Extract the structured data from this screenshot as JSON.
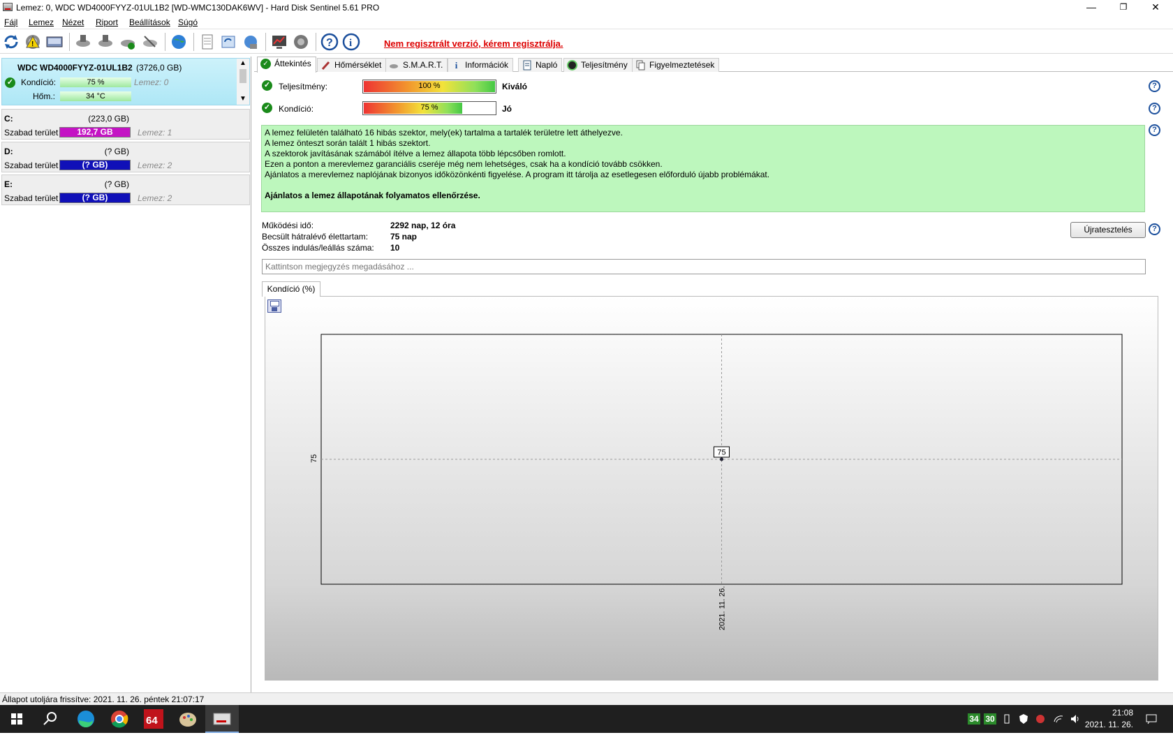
{
  "window": {
    "title": "Lemez: 0, WDC WD4000FYYZ-01UL1B2 [WD-WMC130DAK6WV]  -  Hard Disk Sentinel 5.61 PRO",
    "minimize": "—",
    "restore": "❐",
    "close": "✕"
  },
  "menu": {
    "items": [
      "Fájl",
      "Lemez",
      "Nézet",
      "Riport",
      "Beállítások",
      "Súgó"
    ]
  },
  "toolbar": {
    "register_text": "Nem regisztrált verzió, kérem regisztrálja."
  },
  "disk": {
    "name": "WDC WD4000FYYZ-01UL1B2",
    "size": "(3726,0 GB)",
    "condition_label": "Kondíció:",
    "condition_value": "75 %",
    "condition_fraction": 0.75,
    "disk_index": "Lemez: 0",
    "temp_label": "Hőm.:",
    "temp_value": "34 °C"
  },
  "volumes": [
    {
      "name": "C:",
      "size": "(223,0 GB)",
      "free_label": "Szabad terület",
      "free_value": "192,7 GB",
      "disk": "Lemez: 1",
      "bar_color": "#c413c4"
    },
    {
      "name": "D:",
      "size": "(? GB)",
      "free_label": "Szabad terület",
      "free_value": "(? GB)",
      "disk": "Lemez: 2",
      "bar_color": "#1010b8"
    },
    {
      "name": "E:",
      "size": "(? GB)",
      "free_label": "Szabad terület",
      "free_value": "(? GB)",
      "disk": "Lemez: 2",
      "bar_color": "#1010b8"
    }
  ],
  "tabs": [
    {
      "label": "Áttekintés",
      "icon": "check-icon",
      "active": true
    },
    {
      "label": "Hőmérséklet",
      "icon": "thermometer-icon",
      "active": false
    },
    {
      "label": "S.M.A.R.T.",
      "icon": "smart-icon",
      "active": false
    },
    {
      "label": "Információk",
      "icon": "info-icon",
      "active": false
    },
    {
      "label": "Napló",
      "icon": "log-icon",
      "active": false
    },
    {
      "label": "Teljesítmény",
      "icon": "performance-icon",
      "active": false
    },
    {
      "label": "Figyelmeztetések",
      "icon": "alerts-icon",
      "active": false
    }
  ],
  "overview": {
    "performance_label": "Teljesítmény:",
    "performance_value": "100 %",
    "performance_fraction": 1.0,
    "performance_rating": "Kiváló",
    "condition_label": "Kondíció:",
    "condition_value": "75 %",
    "condition_fraction": 0.75,
    "condition_rating": "Jó",
    "status_lines": [
      "A lemez felületén található 16 hibás szektor, mely(ek) tartalma a tartalék területre lett áthelyezve.",
      "A lemez önteszt során talált 1 hibás szektort.",
      "A szektorok javításának számából ítélve a lemez állapota több lépcsőben romlott.",
      "Ezen a ponton a merevlemez garanciális cseréje még nem lehetséges, csak ha a kondíció tovább csökken.",
      "Ajánlatos a merevlemez naplójának bizonyos időközönkénti figyelése. A program itt tárolja az esetlegesen előforduló újabb problémákat."
    ],
    "status_bold": "Ajánlatos a lemez állapotának folyamatos ellenőrzése.",
    "uptime_label": "Működési idő:",
    "uptime_value": "2292 nap, 12 óra",
    "remaining_label": "Becsült hátralévő élettartam:",
    "remaining_value": "75 nap",
    "starts_label": "Összes indulás/leállás száma:",
    "starts_value": "10",
    "retest_button": "Újratesztelés",
    "note_placeholder": "Kattintson megjegyzés megadásához ..."
  },
  "chart_tab": "Kondíció  (%)",
  "chart_data": {
    "type": "line",
    "x": [
      "2021. 11. 26."
    ],
    "series": [
      {
        "values": [
          75
        ]
      }
    ],
    "ytick": "75",
    "point_label": "75",
    "grid": true
  },
  "statusbar": {
    "text": "Állapot utoljára frissítve: 2021. 11. 26. péntek 21:07:17"
  },
  "taskbar": {
    "tray_temp1": "34",
    "tray_temp2": "30",
    "time": "21:08",
    "date": "2021. 11. 26."
  }
}
